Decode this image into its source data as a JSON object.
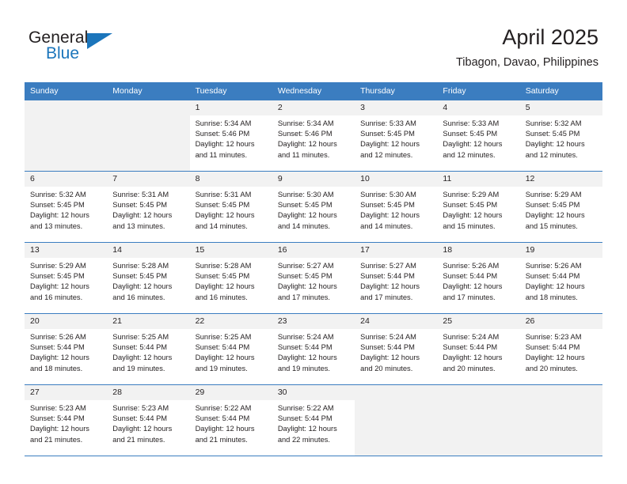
{
  "brand": {
    "name_part1": "General",
    "name_part2": "Blue",
    "flag_icon": "triangle-flag-icon"
  },
  "header": {
    "title": "April 2025",
    "subtitle": "Tibagon, Davao, Philippines"
  },
  "colors": {
    "header_blue": "#3b7dc0",
    "brand_blue": "#1b75bb",
    "daynum_band": "#f2f2f2",
    "text": "#231f20"
  },
  "weekday_headers": [
    "Sunday",
    "Monday",
    "Tuesday",
    "Wednesday",
    "Thursday",
    "Friday",
    "Saturday"
  ],
  "weeks": [
    [
      {
        "day": "",
        "lines": []
      },
      {
        "day": "",
        "lines": []
      },
      {
        "day": "1",
        "lines": [
          "Sunrise: 5:34 AM",
          "Sunset: 5:46 PM",
          "Daylight: 12 hours",
          "and 11 minutes."
        ]
      },
      {
        "day": "2",
        "lines": [
          "Sunrise: 5:34 AM",
          "Sunset: 5:46 PM",
          "Daylight: 12 hours",
          "and 11 minutes."
        ]
      },
      {
        "day": "3",
        "lines": [
          "Sunrise: 5:33 AM",
          "Sunset: 5:45 PM",
          "Daylight: 12 hours",
          "and 12 minutes."
        ]
      },
      {
        "day": "4",
        "lines": [
          "Sunrise: 5:33 AM",
          "Sunset: 5:45 PM",
          "Daylight: 12 hours",
          "and 12 minutes."
        ]
      },
      {
        "day": "5",
        "lines": [
          "Sunrise: 5:32 AM",
          "Sunset: 5:45 PM",
          "Daylight: 12 hours",
          "and 12 minutes."
        ]
      }
    ],
    [
      {
        "day": "6",
        "lines": [
          "Sunrise: 5:32 AM",
          "Sunset: 5:45 PM",
          "Daylight: 12 hours",
          "and 13 minutes."
        ]
      },
      {
        "day": "7",
        "lines": [
          "Sunrise: 5:31 AM",
          "Sunset: 5:45 PM",
          "Daylight: 12 hours",
          "and 13 minutes."
        ]
      },
      {
        "day": "8",
        "lines": [
          "Sunrise: 5:31 AM",
          "Sunset: 5:45 PM",
          "Daylight: 12 hours",
          "and 14 minutes."
        ]
      },
      {
        "day": "9",
        "lines": [
          "Sunrise: 5:30 AM",
          "Sunset: 5:45 PM",
          "Daylight: 12 hours",
          "and 14 minutes."
        ]
      },
      {
        "day": "10",
        "lines": [
          "Sunrise: 5:30 AM",
          "Sunset: 5:45 PM",
          "Daylight: 12 hours",
          "and 14 minutes."
        ]
      },
      {
        "day": "11",
        "lines": [
          "Sunrise: 5:29 AM",
          "Sunset: 5:45 PM",
          "Daylight: 12 hours",
          "and 15 minutes."
        ]
      },
      {
        "day": "12",
        "lines": [
          "Sunrise: 5:29 AM",
          "Sunset: 5:45 PM",
          "Daylight: 12 hours",
          "and 15 minutes."
        ]
      }
    ],
    [
      {
        "day": "13",
        "lines": [
          "Sunrise: 5:29 AM",
          "Sunset: 5:45 PM",
          "Daylight: 12 hours",
          "and 16 minutes."
        ]
      },
      {
        "day": "14",
        "lines": [
          "Sunrise: 5:28 AM",
          "Sunset: 5:45 PM",
          "Daylight: 12 hours",
          "and 16 minutes."
        ]
      },
      {
        "day": "15",
        "lines": [
          "Sunrise: 5:28 AM",
          "Sunset: 5:45 PM",
          "Daylight: 12 hours",
          "and 16 minutes."
        ]
      },
      {
        "day": "16",
        "lines": [
          "Sunrise: 5:27 AM",
          "Sunset: 5:45 PM",
          "Daylight: 12 hours",
          "and 17 minutes."
        ]
      },
      {
        "day": "17",
        "lines": [
          "Sunrise: 5:27 AM",
          "Sunset: 5:44 PM",
          "Daylight: 12 hours",
          "and 17 minutes."
        ]
      },
      {
        "day": "18",
        "lines": [
          "Sunrise: 5:26 AM",
          "Sunset: 5:44 PM",
          "Daylight: 12 hours",
          "and 17 minutes."
        ]
      },
      {
        "day": "19",
        "lines": [
          "Sunrise: 5:26 AM",
          "Sunset: 5:44 PM",
          "Daylight: 12 hours",
          "and 18 minutes."
        ]
      }
    ],
    [
      {
        "day": "20",
        "lines": [
          "Sunrise: 5:26 AM",
          "Sunset: 5:44 PM",
          "Daylight: 12 hours",
          "and 18 minutes."
        ]
      },
      {
        "day": "21",
        "lines": [
          "Sunrise: 5:25 AM",
          "Sunset: 5:44 PM",
          "Daylight: 12 hours",
          "and 19 minutes."
        ]
      },
      {
        "day": "22",
        "lines": [
          "Sunrise: 5:25 AM",
          "Sunset: 5:44 PM",
          "Daylight: 12 hours",
          "and 19 minutes."
        ]
      },
      {
        "day": "23",
        "lines": [
          "Sunrise: 5:24 AM",
          "Sunset: 5:44 PM",
          "Daylight: 12 hours",
          "and 19 minutes."
        ]
      },
      {
        "day": "24",
        "lines": [
          "Sunrise: 5:24 AM",
          "Sunset: 5:44 PM",
          "Daylight: 12 hours",
          "and 20 minutes."
        ]
      },
      {
        "day": "25",
        "lines": [
          "Sunrise: 5:24 AM",
          "Sunset: 5:44 PM",
          "Daylight: 12 hours",
          "and 20 minutes."
        ]
      },
      {
        "day": "26",
        "lines": [
          "Sunrise: 5:23 AM",
          "Sunset: 5:44 PM",
          "Daylight: 12 hours",
          "and 20 minutes."
        ]
      }
    ],
    [
      {
        "day": "27",
        "lines": [
          "Sunrise: 5:23 AM",
          "Sunset: 5:44 PM",
          "Daylight: 12 hours",
          "and 21 minutes."
        ]
      },
      {
        "day": "28",
        "lines": [
          "Sunrise: 5:23 AM",
          "Sunset: 5:44 PM",
          "Daylight: 12 hours",
          "and 21 minutes."
        ]
      },
      {
        "day": "29",
        "lines": [
          "Sunrise: 5:22 AM",
          "Sunset: 5:44 PM",
          "Daylight: 12 hours",
          "and 21 minutes."
        ]
      },
      {
        "day": "30",
        "lines": [
          "Sunrise: 5:22 AM",
          "Sunset: 5:44 PM",
          "Daylight: 12 hours",
          "and 22 minutes."
        ]
      },
      {
        "day": "",
        "lines": []
      },
      {
        "day": "",
        "lines": []
      },
      {
        "day": "",
        "lines": []
      }
    ]
  ]
}
